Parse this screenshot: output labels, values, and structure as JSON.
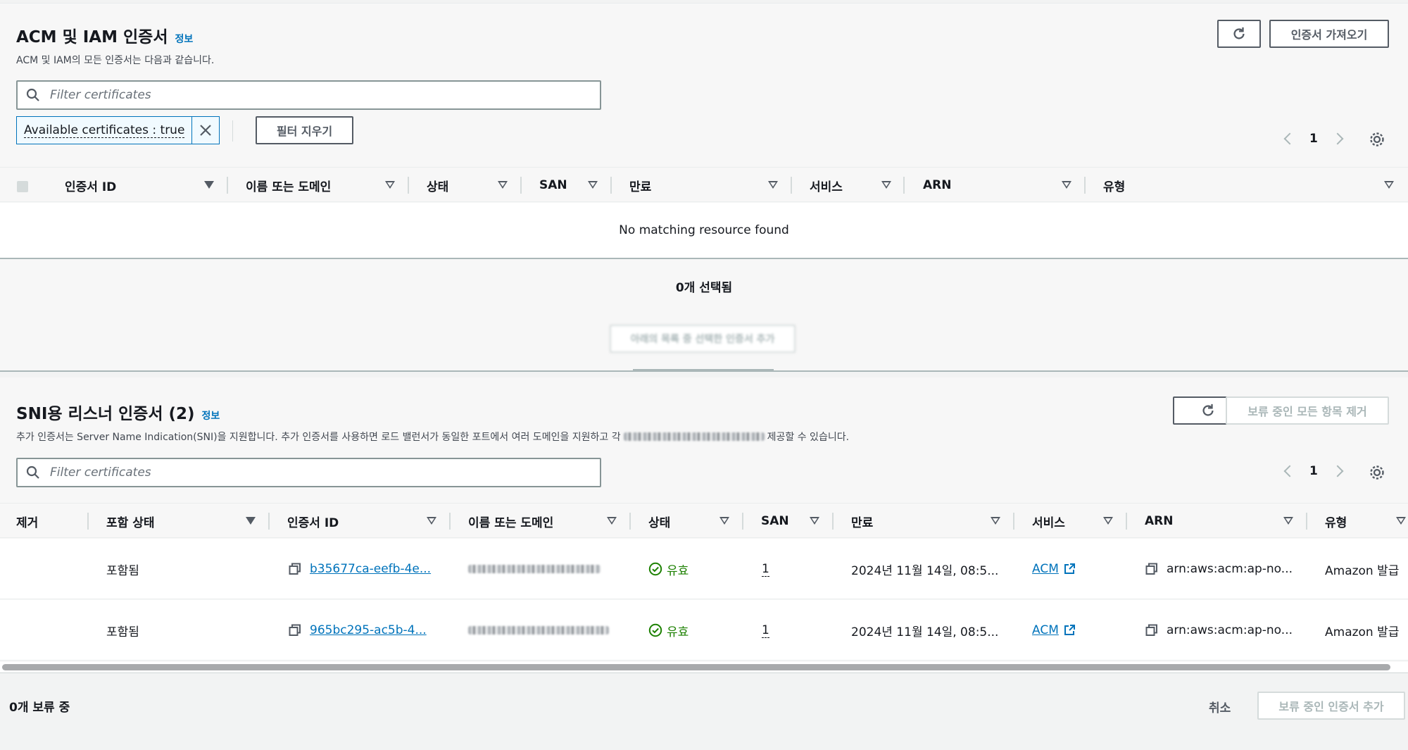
{
  "acm": {
    "title": "ACM 및 IAM 인증서",
    "info": "정보",
    "description": "ACM 및 IAM의 모든 인증서는 다음과 같습니다.",
    "import_button": "인증서 가져오기",
    "search_placeholder": "Filter certificates",
    "filter_token": "Available certificates : true",
    "clear_filters": "필터 지우기",
    "page": "1",
    "columns": [
      "인증서 ID",
      "이름 또는 도메인",
      "상태",
      "SAN",
      "만료",
      "서비스",
      "ARN",
      "유형"
    ],
    "empty_message": "No matching resource found",
    "selected_text": "0개 선택됨",
    "add_pending_button": "아래의 목록 중 선택한 인증서 추가"
  },
  "sni": {
    "title": "SNI용 리스너 인증서",
    "count": "(2)",
    "info": "정보",
    "description_start": "추가 인증서는 Server Name Indication(SNI)을 지원합니다. 추가 인증서를 사용하면 로드 밸런서가 동일한 포트에서 여러 도메인을 지원하고 각 ",
    "description_end": "제공할 수 있습니다.",
    "remove_all_button": "보류 중인 모든 항목 제거",
    "search_placeholder": "Filter certificates",
    "page": "1",
    "columns": [
      "제거",
      "포함 상태",
      "인증서 ID",
      "이름 또는 도메인",
      "상태",
      "SAN",
      "만료",
      "서비스",
      "ARN",
      "유형"
    ],
    "rows": [
      {
        "inclusion": "포함됨",
        "cert_id": "b35677ca-eefb-4e...",
        "status": "유효",
        "san": "1",
        "expiry": "2024년 11월 14일, 08:5...",
        "service": "ACM",
        "arn": "arn:aws:acm:ap-no...",
        "type": "Amazon 발급"
      },
      {
        "inclusion": "포함됨",
        "cert_id": "965bc295-ac5b-4...",
        "status": "유효",
        "san": "1",
        "expiry": "2024년 11월 14일, 08:5...",
        "service": "ACM",
        "arn": "arn:aws:acm:ap-no...",
        "type": "Amazon 발급"
      }
    ]
  },
  "footer": {
    "pending_text": "0개 보류 중",
    "cancel": "취소",
    "add_pending": "보류 중인 인증서 추가"
  },
  "colors": {
    "link": "#0073bb",
    "success": "#1d8102",
    "border_dark": "#545b64"
  }
}
